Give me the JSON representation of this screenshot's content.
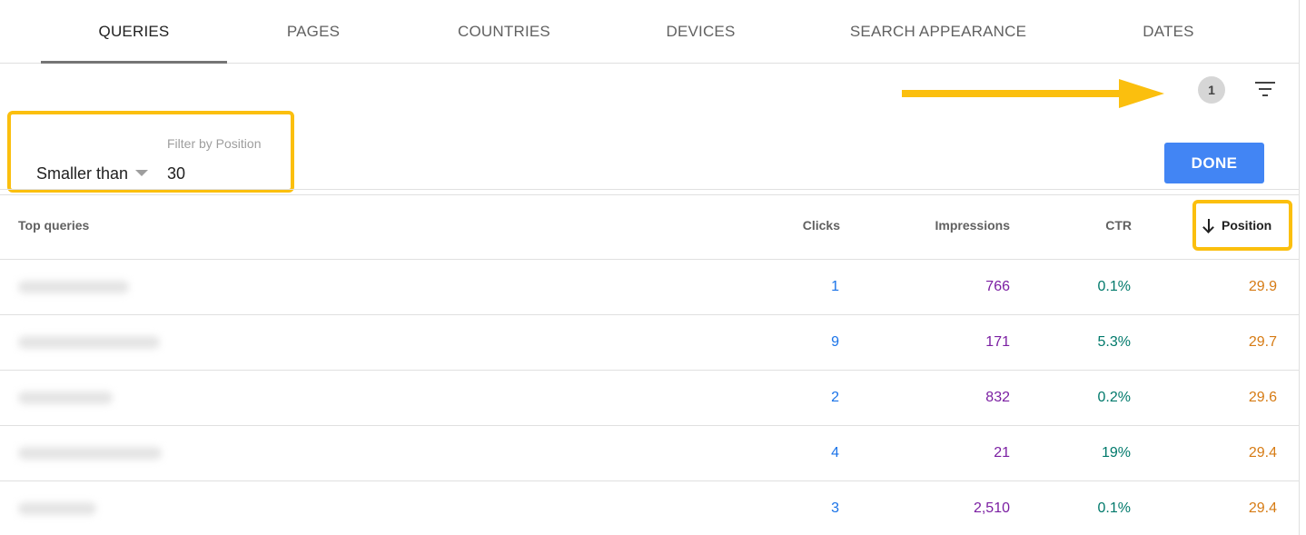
{
  "tabs": [
    {
      "label": "QUERIES",
      "active": true
    },
    {
      "label": "PAGES",
      "active": false
    },
    {
      "label": "COUNTRIES",
      "active": false
    },
    {
      "label": "DEVICES",
      "active": false
    },
    {
      "label": "SEARCH APPEARANCE",
      "active": false
    },
    {
      "label": "DATES",
      "active": false
    }
  ],
  "toolbar": {
    "filter_count": "1",
    "filter_icon": "filter-list-icon"
  },
  "filter": {
    "label": "Filter by Position",
    "operator": "Smaller than",
    "value": "30",
    "done_label": "DONE"
  },
  "table": {
    "headers": {
      "query": "Top queries",
      "clicks": "Clicks",
      "impressions": "Impressions",
      "ctr": "CTR",
      "position": "Position"
    },
    "sort_icon": "arrow-downward-icon",
    "rows": [
      {
        "clicks": "1",
        "impressions": "766",
        "ctr": "0.1%",
        "position": "29.9"
      },
      {
        "clicks": "9",
        "impressions": "171",
        "ctr": "5.3%",
        "position": "29.7"
      },
      {
        "clicks": "2",
        "impressions": "832",
        "ctr": "0.2%",
        "position": "29.6"
      },
      {
        "clicks": "4",
        "impressions": "21",
        "ctr": "19%",
        "position": "29.4"
      },
      {
        "clicks": "3",
        "impressions": "2,510",
        "ctr": "0.1%",
        "position": "29.4"
      }
    ]
  },
  "colors": {
    "highlight": "#fbbf0e",
    "done_button": "#4285f4",
    "clicks": "#1a73e8",
    "impressions": "#7b1fa2",
    "ctr": "#00796b",
    "position": "#d67b14"
  }
}
